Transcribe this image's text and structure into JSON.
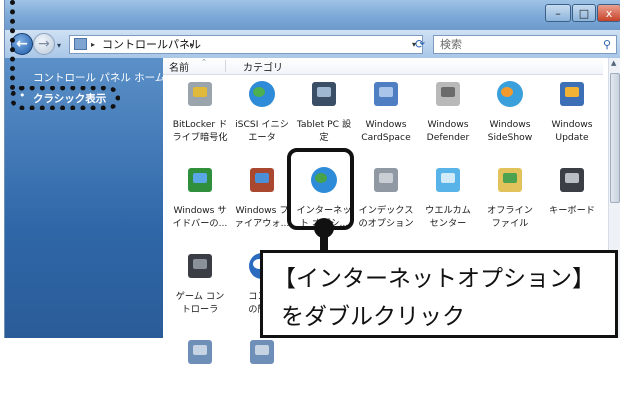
{
  "window": {
    "min_label": "–",
    "max_label": "□",
    "close_label": "x"
  },
  "address": {
    "path_label": "コントロールパネル",
    "sep1": "▸",
    "sep2": "▸",
    "dropdown": "▾",
    "refresh_icon": "refresh-icon",
    "search_placeholder": "検索"
  },
  "sidebar": {
    "home_label": "コントロール パネル ホーム",
    "classic_label": "クラシック表示",
    "bullet": "•"
  },
  "columns": {
    "name": "名前",
    "category": "カテゴリ",
    "sort_indicator": "⌃"
  },
  "items": [
    {
      "label": "BitLocker ド\nライブ暗号化",
      "icon": "bitlocker-icon"
    },
    {
      "label": "iSCSI イニシ\nエータ",
      "icon": "globe-icon"
    },
    {
      "label": "Tablet PC 設\n定",
      "icon": "tablet-pen-icon"
    },
    {
      "label": "Windows\nCardSpace",
      "icon": "cardspace-icon"
    },
    {
      "label": "Windows\nDefender",
      "icon": "defender-icon"
    },
    {
      "label": "Windows\nSideShow",
      "icon": "sideshow-icon"
    },
    {
      "label": "Windows\nUpdate",
      "icon": "update-icon"
    },
    {
      "label": "Windows サ\nイドバーの...",
      "icon": "sidebar-icon"
    },
    {
      "label": "Windows フ\nァイアウォ...",
      "icon": "firewall-icon"
    },
    {
      "label": "インターネッ\nト オプシ...",
      "icon": "internet-options-icon"
    },
    {
      "label": "インデックス\nのオプション",
      "icon": "index-icon"
    },
    {
      "label": "ウエルカム\nセンター",
      "icon": "welcome-icon"
    },
    {
      "label": "オフライン\nファイル",
      "icon": "offline-files-icon"
    },
    {
      "label": "キーボード",
      "icon": "keyboard-icon"
    },
    {
      "label": "ゲーム コン\nトローラ",
      "icon": "game-controller-icon"
    },
    {
      "label": "コンピ\nの簡単",
      "icon": "ease-of-access-icon"
    },
    {
      "label": "",
      "icon": "item-icon"
    },
    {
      "label": "",
      "icon": "item-icon"
    },
    {
      "label": "",
      "icon": "item-icon"
    },
    {
      "label": "",
      "icon": "item-icon"
    },
    {
      "label": "",
      "icon": "item-icon"
    },
    {
      "label": "",
      "icon": "item-icon"
    },
    {
      "label": "",
      "icon": "item-icon"
    }
  ],
  "callout": {
    "line1": "【インターネットオプション】",
    "line2": "をダブルクリック"
  },
  "colors": {
    "sidebar": "#2f67a8",
    "accent": "#1d5aa8"
  }
}
